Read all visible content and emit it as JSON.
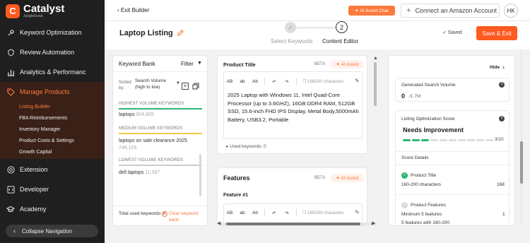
{
  "brand": {
    "name": "Catalyst",
    "sub": "JungleScout",
    "mark": "C",
    "accent": "#ff5a1f"
  },
  "sidebar": {
    "items": [
      {
        "label": "Keyword Optimization",
        "icon": "wrench-icon"
      },
      {
        "label": "Review Automation",
        "icon": "shield-chat-icon"
      },
      {
        "label": "Analytics & Performanc",
        "icon": "bar-chart-icon"
      },
      {
        "label": "Manage Products",
        "icon": "tag-icon"
      },
      {
        "label": "Extension",
        "icon": "chrome-icon"
      },
      {
        "label": "Developer",
        "icon": "code-icon"
      },
      {
        "label": "Academy",
        "icon": "graduation-cap-icon"
      }
    ],
    "sub_items": [
      "Listing Builder",
      "FBA Reimbursements",
      "Inventory Manager",
      "Product Costs & Settings",
      "Growth Capital"
    ],
    "collapse_label": "Collapse Navigation"
  },
  "topbar": {
    "exit_builder": "Exit Builder",
    "ai_chat": "AI Assist Chat",
    "connect_amazon": "Connect an Amazon Account",
    "avatar_initials": "HK"
  },
  "header": {
    "title": "Laptop Listing",
    "steps": [
      {
        "number": "✓",
        "label": "Select Keywords"
      },
      {
        "number": "2",
        "label": "Content Editor"
      }
    ],
    "saved": "Saved",
    "save_exit": "Save & Exit"
  },
  "keyword_bank": {
    "title": "Keyword Bank",
    "filter": "Filter",
    "sorted_by": "Sorted by:",
    "sort_value": "Search Volume (high to low)",
    "groups": [
      {
        "heading": "HIGHEST VOLUME KEYWORDS",
        "color": "#2bb673",
        "keywords": [
          {
            "text": "laptops",
            "volume": "904,905"
          }
        ]
      },
      {
        "heading": "MEDIUM VOLUME KEYWORDS",
        "color": "#f2c94c",
        "keywords": [
          {
            "text": "laptops on sale clearance 2025",
            "volume": "748,129"
          }
        ]
      },
      {
        "heading": "LOWEST VOLUME KEYWORDS",
        "color": "#cccccc",
        "keywords": [
          {
            "text": "dell laptops",
            "volume": "11,587"
          }
        ]
      }
    ],
    "total_used_label": "Total used keywords:",
    "total_used_value": "0",
    "clear_bank": "Clear keyword bank"
  },
  "product_title": {
    "title": "Product Title",
    "beta": "BETA",
    "ai_assist": "AI Assist",
    "toolbar": [
      "AB",
      "ab",
      "Ab"
    ],
    "char_count": "168/200 characters",
    "text": "2025 Laptop with Windows 11, Intel Quad-Core Processor (up to 3.6GHZ), 16GB DDR4 RAM, 512GB SSD, 15.6-inch FHD IPS Display, Metal Body,5000mAh Battery, USB3.2, Portable",
    "used_keywords": "Used keywords: 0"
  },
  "features": {
    "title": "Features",
    "beta": "BETA",
    "ai_assist": "AI Assist",
    "feature_label": "Feature #1",
    "toolbar": [
      "AB",
      "ab",
      "Ab"
    ],
    "char_count": "160/200 characters"
  },
  "right_panel": {
    "hide": "Hide",
    "search_volume_label": "Generated Search Volume",
    "search_volume_value": "0",
    "search_volume_total": "/1.7M",
    "score_label": "Listing Optimization Score",
    "score_status": "Needs Improvement",
    "score_value": "3/10",
    "score_fraction": 0.3,
    "details_title": "Score Details",
    "details": [
      {
        "label": "Product Title",
        "status": "pass",
        "sub": "160-200 characters",
        "value": "168"
      },
      {
        "label": "Product Features",
        "status": "pending",
        "sub": "Minimum 5 features",
        "value": "1",
        "sub2": "5 features with 160-200"
      }
    ]
  }
}
